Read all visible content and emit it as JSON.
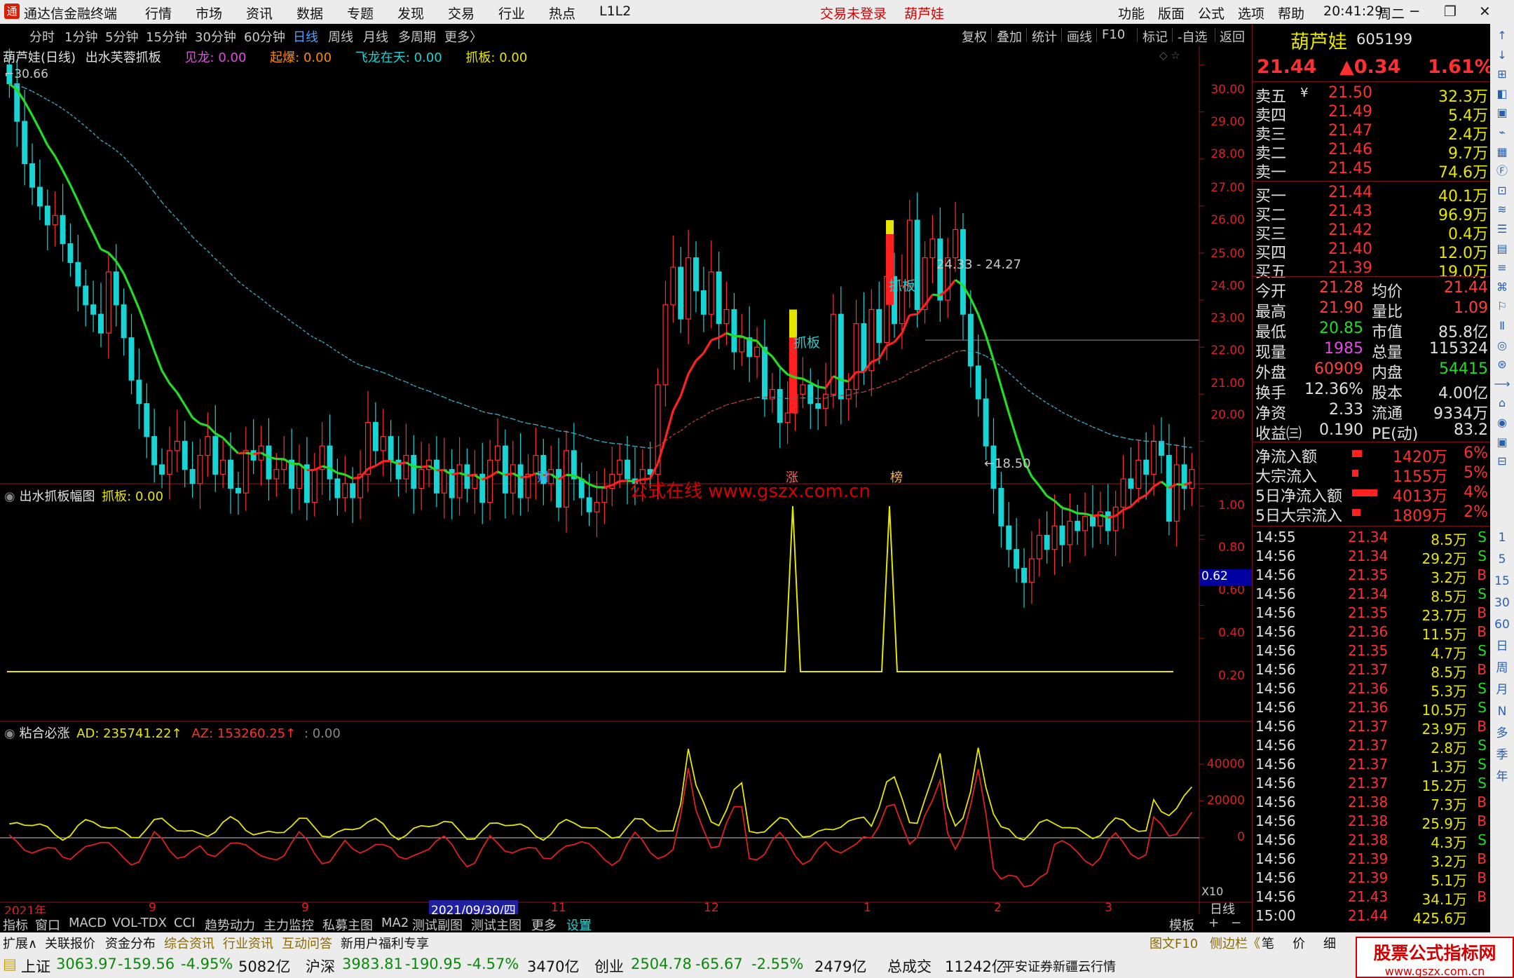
{
  "menubar": {
    "app_title": "通达信金融终端",
    "menus": [
      "行情",
      "市场",
      "资讯",
      "数据",
      "专题",
      "发现",
      "交易",
      "行业",
      "热点",
      "L1L2"
    ],
    "trade_status": "交易未登录",
    "stock_short": "葫芦娃",
    "right_menus": [
      "功能",
      "版面",
      "公式",
      "选项",
      "帮助"
    ],
    "time": "20:41:29",
    "weekday": "周二"
  },
  "timeframes": [
    "分时",
    "1分钟",
    "5分钟",
    "15分钟",
    "30分钟",
    "60分钟",
    "日线",
    "周线",
    "月线",
    "多周期",
    "更多〉"
  ],
  "active_timeframe": "日线",
  "chart_buttons": [
    "复权",
    "叠加",
    "统计",
    "画线",
    "F10",
    "标记",
    "-自选",
    "返回"
  ],
  "main_panel": {
    "legend": {
      "name": "葫芦娃(日线)",
      "formula": "出水芙蓉抓板",
      "items": [
        {
          "k": "见龙:",
          "v": "0.00",
          "color": "#e24ce2"
        },
        {
          "k": "起爆:",
          "v": "0.00",
          "color": "#ff8a00"
        },
        {
          "k": "飞龙在天:",
          "v": "0.00",
          "color": "#19d4d4"
        },
        {
          "k": "抓板:",
          "v": "0.00",
          "color": "#e6e600"
        }
      ]
    },
    "high_label": "30.66",
    "low_label": "←18.50",
    "range_label": "24.33 - 24.27",
    "signal1": "抓板",
    "signal2": "抓板",
    "markers": [
      {
        "t": "财",
        "color": "#4aa3ff"
      },
      {
        "t": "涨",
        "color": "#ff6060"
      },
      {
        "t": "榜",
        "color": "#ffb040"
      }
    ],
    "watermark": "公式在线 www.gszx.com.cn",
    "yaxis": [
      "30.00",
      "29.00",
      "28.00",
      "27.00",
      "26.00",
      "25.00",
      "24.00",
      "23.00",
      "22.00",
      "21.00",
      "20.00"
    ]
  },
  "sub1": {
    "title": "出水抓板幅图",
    "item_k": "抓板:",
    "item_v": "0.00",
    "yaxis": [
      "1.00",
      "0.80",
      "0.60",
      "0.40",
      "0.20"
    ],
    "cursor_value": "0.62"
  },
  "sub2": {
    "title": "粘合必涨",
    "ad_k": "AD:",
    "ad_v": "235741.22↑",
    "az_k": "AZ:",
    "az_v": "153260.25↑",
    "extra": ": 0.00",
    "yaxis": [
      "40000",
      "20000",
      "0"
    ],
    "x10": "X10"
  },
  "xaxis": {
    "labels": [
      "2021年",
      "9",
      "2021/09/30/四",
      "11",
      "12",
      "1",
      "2",
      "3"
    ],
    "period": "日线"
  },
  "quote": {
    "name": "葫芦娃",
    "code": "605199",
    "price": "21.44",
    "change": "▲0.34",
    "pct": "1.61%",
    "asks": [
      {
        "l": "卖五",
        "p": "21.50",
        "v": "32.3万"
      },
      {
        "l": "卖四",
        "p": "21.49",
        "v": "5.4万"
      },
      {
        "l": "卖三",
        "p": "21.47",
        "v": "2.4万"
      },
      {
        "l": "卖二",
        "p": "21.46",
        "v": "9.7万"
      },
      {
        "l": "卖一",
        "p": "21.45",
        "v": "74.6万"
      }
    ],
    "ask_mark": "¥",
    "bids": [
      {
        "l": "买一",
        "p": "21.44",
        "v": "40.1万"
      },
      {
        "l": "买二",
        "p": "21.43",
        "v": "96.9万"
      },
      {
        "l": "买三",
        "p": "21.42",
        "v": "0.4万"
      },
      {
        "l": "买四",
        "p": "21.40",
        "v": "12.0万"
      },
      {
        "l": "买五",
        "p": "21.39",
        "v": "19.0万"
      }
    ],
    "stats": [
      {
        "l1": "今开",
        "v1": "21.28",
        "c1": "#ff4040",
        "l2": "均价",
        "v2": "21.44",
        "c2": "#ff4040"
      },
      {
        "l1": "最高",
        "v1": "21.90",
        "c1": "#ff4040",
        "l2": "量比",
        "v2": "1.09",
        "c2": "#ff4040"
      },
      {
        "l1": "最低",
        "v1": "20.85",
        "c1": "#22dd22",
        "l2": "市值",
        "v2": "85.8亿",
        "c2": "#e0e0e0"
      },
      {
        "l1": "现量",
        "v1": "1985",
        "c1": "#e24ce2",
        "l2": "总量",
        "v2": "115324",
        "c2": "#e0e0e0"
      },
      {
        "l1": "外盘",
        "v1": "60909",
        "c1": "#ff4040",
        "l2": "内盘",
        "v2": "54415",
        "c2": "#22dd22"
      },
      {
        "l1": "换手",
        "v1": "12.36%",
        "c1": "#e0e0e0",
        "l2": "股本",
        "v2": "4.00亿",
        "c2": "#e0e0e0"
      },
      {
        "l1": "净资",
        "v1": "2.33",
        "c1": "#e0e0e0",
        "l2": "流通",
        "v2": "9334万",
        "c2": "#e0e0e0"
      },
      {
        "l1": "收益㈢",
        "v1": "0.190",
        "c1": "#e0e0e0",
        "l2": "PE(动)",
        "v2": "83.2",
        "c2": "#e0e0e0"
      }
    ],
    "flows": [
      {
        "l": "净流入额",
        "v": "1420万",
        "p": "6%",
        "w": 14
      },
      {
        "l": "大宗流入",
        "v": "1155万",
        "p": "5%",
        "w": 9
      },
      {
        "l": "5日净流入额",
        "v": "4013万",
        "p": "4%",
        "w": 36
      },
      {
        "l": "5日大宗流入",
        "v": "1809万",
        "p": "2%",
        "w": 12
      }
    ],
    "ticks": [
      {
        "t": "14:55",
        "p": "21.34",
        "v": "8.5万",
        "s": "S"
      },
      {
        "t": "14:56",
        "p": "21.34",
        "v": "29.2万",
        "s": "S"
      },
      {
        "t": "14:56",
        "p": "21.35",
        "v": "3.2万",
        "s": "B"
      },
      {
        "t": "14:56",
        "p": "21.34",
        "v": "8.5万",
        "s": "S"
      },
      {
        "t": "14:56",
        "p": "21.35",
        "v": "23.7万",
        "s": "B"
      },
      {
        "t": "14:56",
        "p": "21.36",
        "v": "11.5万",
        "s": "B"
      },
      {
        "t": "14:56",
        "p": "21.35",
        "v": "4.7万",
        "s": "S"
      },
      {
        "t": "14:56",
        "p": "21.37",
        "v": "8.5万",
        "s": "B"
      },
      {
        "t": "14:56",
        "p": "21.36",
        "v": "5.3万",
        "s": "S"
      },
      {
        "t": "14:56",
        "p": "21.36",
        "v": "10.5万",
        "s": "S"
      },
      {
        "t": "14:56",
        "p": "21.37",
        "v": "23.9万",
        "s": "B"
      },
      {
        "t": "14:56",
        "p": "21.37",
        "v": "2.8万",
        "s": "S"
      },
      {
        "t": "14:56",
        "p": "21.37",
        "v": "1.3万",
        "s": "S"
      },
      {
        "t": "14:56",
        "p": "21.37",
        "v": "15.2万",
        "s": "S"
      },
      {
        "t": "14:56",
        "p": "21.38",
        "v": "7.3万",
        "s": "B"
      },
      {
        "t": "14:56",
        "p": "21.38",
        "v": "25.9万",
        "s": "B"
      },
      {
        "t": "14:56",
        "p": "21.38",
        "v": "4.3万",
        "s": "S"
      },
      {
        "t": "14:56",
        "p": "21.39",
        "v": "3.2万",
        "s": "B"
      },
      {
        "t": "14:56",
        "p": "21.39",
        "v": "5.1万",
        "s": "B"
      },
      {
        "t": "14:56",
        "p": "21.43",
        "v": "34.1万",
        "s": "B"
      },
      {
        "t": "15:00",
        "p": "21.44",
        "v": "425.6万",
        "s": ""
      }
    ]
  },
  "tools": [
    "↑",
    "↓",
    "⊞",
    "◧",
    "▣",
    "⌁",
    "▦",
    "Ⓕ",
    "⊡",
    "≋",
    "☰",
    "▤",
    "≡",
    "⌘",
    "⚐",
    "Ⅱ",
    "◎",
    "⊛",
    "⟶",
    "⌂",
    "◉",
    "▣",
    "⊟"
  ],
  "tools_text": [
    "1",
    "5",
    "15",
    "30",
    "60",
    "日",
    "周",
    "月",
    "N",
    "多",
    "季",
    "年"
  ],
  "bottom_tabs": [
    "指标",
    "窗口",
    "MACD",
    "VOL-TDX",
    "CCI",
    "趋势动力",
    "主力监控",
    "私募主图",
    "MA2",
    "测试副图",
    "测试主图",
    "更多",
    "设置"
  ],
  "bottom_right": [
    "模板",
    "+",
    "−"
  ],
  "func_tabs": [
    "扩展∧",
    "关联报价",
    "资金分布",
    "综合资讯",
    "行业资讯",
    "互动问答",
    "新用户福利专享"
  ],
  "func_right": [
    "图文F10",
    "侧边栏《",
    "笔",
    "价",
    "细"
  ],
  "status": {
    "i1": "上证",
    "i1v": "3063.97",
    "i1c": "-159.56",
    "i1p": "-4.95%",
    "i1a": "5082亿",
    "i2": "沪深",
    "i2v": "3983.81",
    "i2c": "-190.95",
    "i2p": "-4.57%",
    "i2a": "3470亿",
    "i3": "创业",
    "i3v": "2504.78",
    "i3c": "-65.67",
    "i3p": "-2.55%",
    "i3a": "2479亿",
    "total": "总成交",
    "total_v": "11242亿",
    "broker": "平安证券新疆云行情",
    "badge": "股票公式指标网",
    "badge_url": "www.gszx.com.cn"
  }
}
